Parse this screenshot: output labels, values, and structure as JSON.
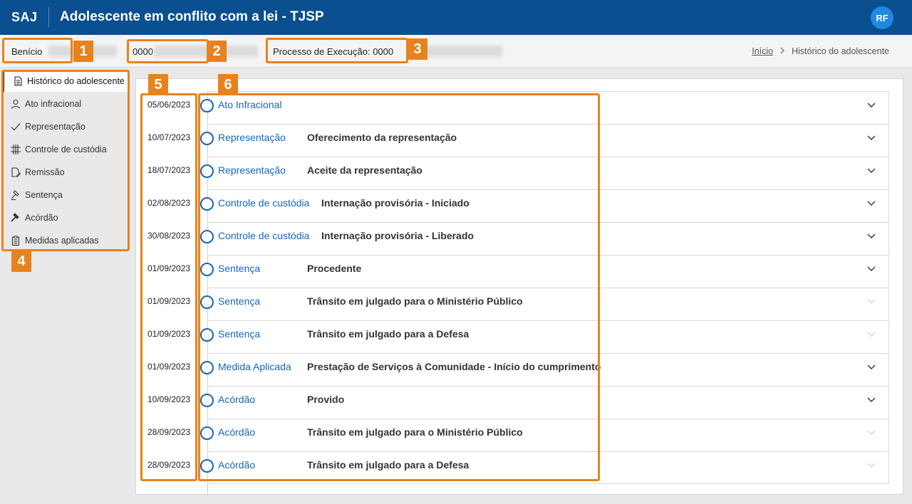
{
  "header": {
    "brand": "SAJ",
    "title": "Adolescente em conflito com a lei - TJSP",
    "avatar": "RF"
  },
  "info": {
    "name": "Benício",
    "process_number": "0000",
    "execution_process": "Processo de Execução: 0000"
  },
  "breadcrumb": {
    "home": "Início",
    "current": "Histórico do adolescente"
  },
  "sidebar": {
    "items": [
      {
        "label": "Histórico do adolescente",
        "icon": "document-icon",
        "active": true
      },
      {
        "label": "Ato infracional",
        "icon": "person-icon"
      },
      {
        "label": "Representação",
        "icon": "check-icon"
      },
      {
        "label": "Controle de custódia",
        "icon": "grid-icon"
      },
      {
        "label": "Remissão",
        "icon": "document-edit-icon"
      },
      {
        "label": "Sentença",
        "icon": "gavel-icon"
      },
      {
        "label": "Acórdão",
        "icon": "gavel-filled-icon"
      },
      {
        "label": "Medidas aplicadas",
        "icon": "clipboard-icon"
      }
    ]
  },
  "timeline": [
    {
      "date": "05/06/2023",
      "type": "Ato Infracional",
      "desc": "",
      "expandable": true
    },
    {
      "date": "10/07/2023",
      "type": "Representação",
      "desc": "Oferecimento da representação",
      "expandable": true
    },
    {
      "date": "18/07/2023",
      "type": "Representação",
      "desc": "Aceite da representação",
      "expandable": true
    },
    {
      "date": "02/08/2023",
      "type": "Controle de custódia",
      "desc": "Internação provisória - Iniciado",
      "expandable": true
    },
    {
      "date": "30/08/2023",
      "type": "Controle de custódia",
      "desc": "Internação provisória - Liberado",
      "expandable": true
    },
    {
      "date": "01/09/2023",
      "type": "Sentença",
      "desc": "Procedente",
      "expandable": true
    },
    {
      "date": "01/09/2023",
      "type": "Sentença",
      "desc": "Trânsito em julgado para o Ministério Público",
      "expandable": false
    },
    {
      "date": "01/09/2023",
      "type": "Sentença",
      "desc": "Trânsito em julgado para a Defesa",
      "expandable": false
    },
    {
      "date": "01/09/2023",
      "type": "Medida Aplicada",
      "desc": "Prestação de Serviços à Comunidade - Início do cumprimento",
      "expandable": true
    },
    {
      "date": "10/09/2023",
      "type": "Acórdão",
      "desc": "Provido",
      "expandable": true
    },
    {
      "date": "28/09/2023",
      "type": "Acórdão",
      "desc": "Trânsito em julgado para o Ministério Público",
      "expandable": false
    },
    {
      "date": "28/09/2023",
      "type": "Acórdão",
      "desc": "Trânsito em julgado para a Defesa",
      "expandable": false
    }
  ],
  "annotations": [
    "1",
    "2",
    "3",
    "4",
    "5",
    "6"
  ],
  "colors": {
    "header": "#0a4f8f",
    "accent": "#1565c0",
    "annotation": "#e8821e"
  }
}
